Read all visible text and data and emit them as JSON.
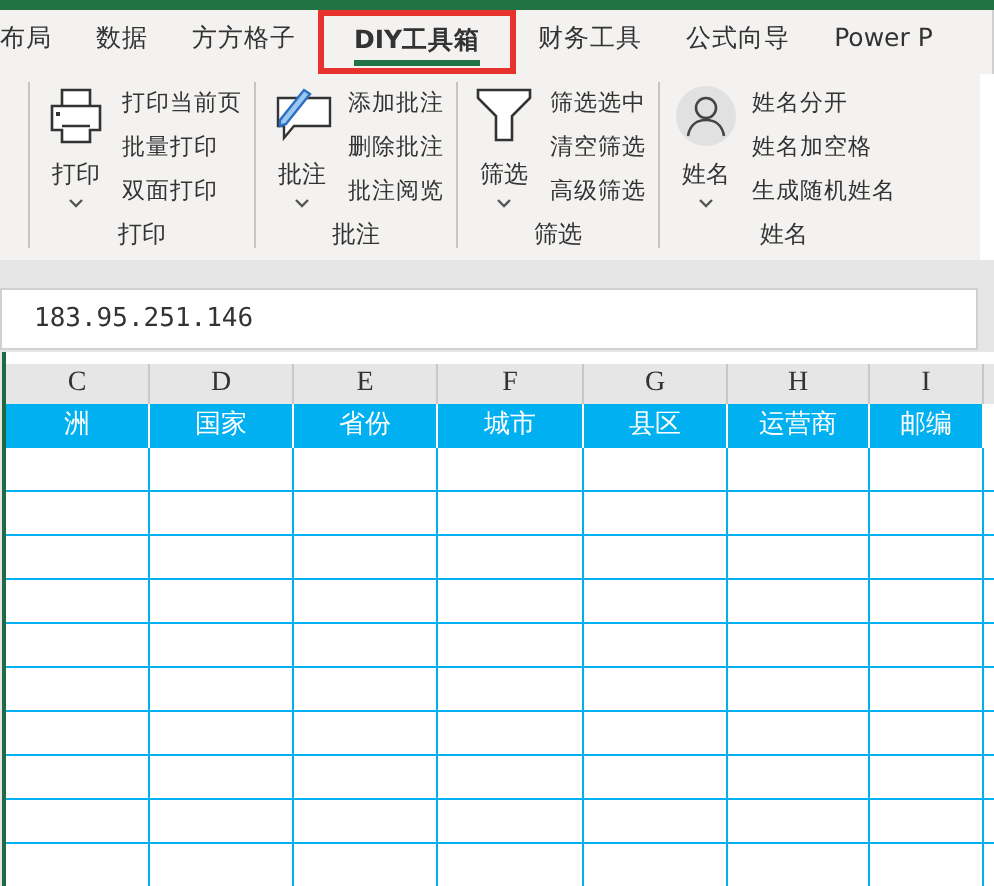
{
  "tabs": [
    {
      "label": "布局",
      "selected": false,
      "highlighted": false
    },
    {
      "label": "数据",
      "selected": false,
      "highlighted": false
    },
    {
      "label": "方方格子",
      "selected": false,
      "highlighted": false
    },
    {
      "label": "DIY工具箱",
      "selected": true,
      "highlighted": true
    },
    {
      "label": "财务工具",
      "selected": false,
      "highlighted": false
    },
    {
      "label": "公式向导",
      "selected": false,
      "highlighted": false
    },
    {
      "label": "Power P",
      "selected": false,
      "highlighted": false
    }
  ],
  "ribbon_groups": [
    {
      "kind": "printer",
      "big_label": "打印",
      "items": [
        "打印当前页",
        "批量打印",
        "双面打印"
      ],
      "title": "打印"
    },
    {
      "kind": "comment",
      "big_label": "批注",
      "items": [
        "添加批注",
        "删除批注",
        "批注阅览"
      ],
      "title": "批注"
    },
    {
      "kind": "filter",
      "big_label": "筛选",
      "items": [
        "筛选选中",
        "清空筛选",
        "高级筛选"
      ],
      "title": "筛选"
    },
    {
      "kind": "person",
      "big_label": "姓名",
      "items": [
        "姓名分开",
        "姓名加空格",
        "生成随机姓名"
      ],
      "title": "姓名"
    }
  ],
  "formula_bar": {
    "value": "183.95.251.146"
  },
  "sheet": {
    "column_letters": [
      "C",
      "D",
      "E",
      "F",
      "G",
      "H",
      "I"
    ],
    "header_row": [
      "洲",
      "国家",
      "省份",
      "城市",
      "县区",
      "运营商",
      "邮编"
    ]
  }
}
